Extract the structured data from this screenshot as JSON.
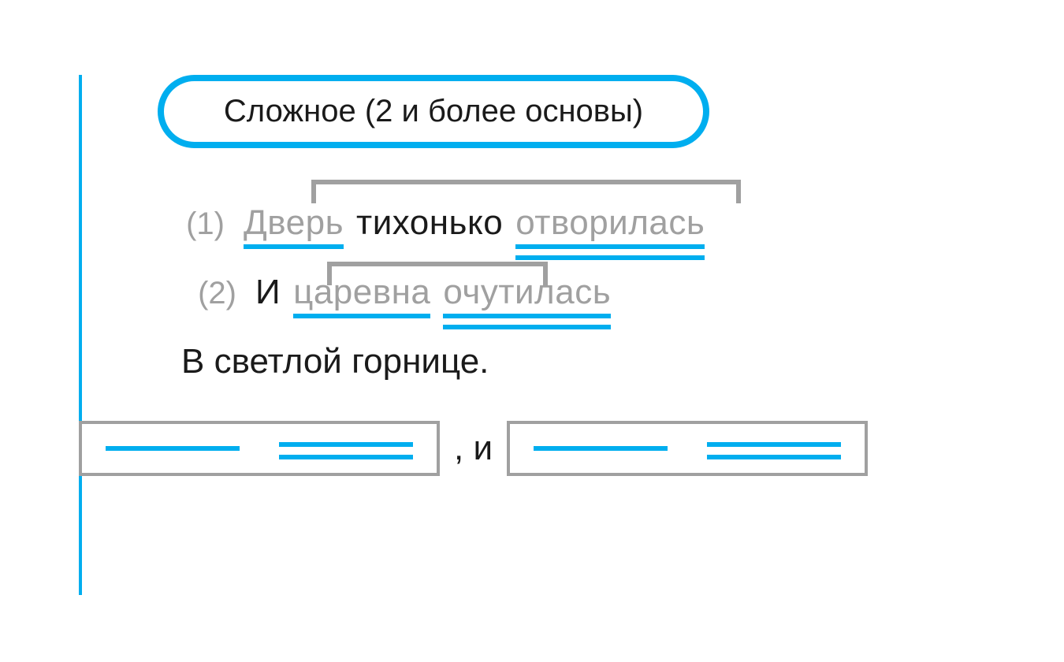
{
  "header": {
    "title": "Сложное (2 и более основы)"
  },
  "lines": {
    "l1": {
      "num": "(1)",
      "w1": "Дверь",
      "w2": "тихонько",
      "w3": "отворилась"
    },
    "l2": {
      "num": "(2)",
      "w1": "И",
      "w2": "царевна",
      "w3": "очутилась"
    },
    "l3": "В светлой горнице."
  },
  "schema": {
    "connector": ", и"
  }
}
